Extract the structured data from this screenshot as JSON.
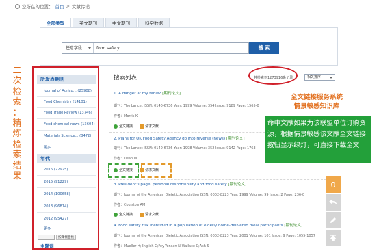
{
  "breadcrumb": {
    "prefix": "您所在的位置：",
    "home": "首页",
    "separator": ">",
    "current": "文献传递"
  },
  "tabs": [
    {
      "label": "全部类型",
      "active": true
    },
    {
      "label": "英文期刊",
      "active": false
    },
    {
      "label": "中文期刊",
      "active": false
    },
    {
      "label": "科学数据",
      "active": false
    }
  ],
  "search": {
    "field_select": "任意字段",
    "query": "food safety",
    "button": "搜 索"
  },
  "annotation_left": [
    "二",
    "次",
    "检",
    "索",
    "：",
    "精",
    "炼",
    "检",
    "索",
    "结",
    "果"
  ],
  "sidebar": {
    "journals_heading": "所发表期刊",
    "journals": [
      "Journal of Agricu... (25908)",
      "Food Chemistry (14101)",
      "Food Trade Review (13746)",
      "Food chemical news (13604)",
      "Materials Science... (8472)"
    ],
    "more_label": "更多",
    "years_heading": "年代",
    "years": [
      "2016 (22925)",
      "2015 (91229)",
      "2014 (100658)",
      "2013 (96814)",
      "2012 (95427)"
    ],
    "year_more": "更多",
    "year_range_button": "按年代查找",
    "subject_heading": "主题词"
  },
  "results": {
    "title": "搜索列表",
    "count": "共检索到1273916条记录",
    "sort": "相关排序",
    "full_text_label": "全文链接",
    "delivery_label": "请求文献",
    "items": [
      {
        "title": "1. A danger at my table?",
        "tag": "[期刊论文]",
        "meta": "期刊：The Lancet ISSN: 0140-6736 Year: 1999 Volume: 354 Issue: 9189 Page: 1565-0",
        "authors": "作者：Morris K"
      },
      {
        "title": "2. Plans for UK Food Safety Agency go into reverse (news)",
        "tag": "[期刊论文]",
        "meta": "期刊：The Lancet ISSN: 0140-6736 Year: 1998 Volume: 352 Issue: 9142 Page: 1763",
        "authors": "作者：Dean M"
      },
      {
        "title": "3. President's page: personal responsibility and food safety",
        "tag": "[期刊论文]",
        "meta": "期刊：Journal of the American Dietetic Association ISSN: 0002-8223 Year: 1999 Volume: 99 Issue: 2 Page: 236-0",
        "authors": "作者：Coulston AM"
      },
      {
        "title": "4. Food safety risk identified in a population of elderly home-delivered meal participants",
        "tag": "[期刊论文]",
        "meta": "期刊：Journal of the American Dietetic Association ISSN: 0002-8223 Year: 2001 Volume: 101 Issue: 9 Page: 1055-1057",
        "authors": "作者：Mueller H;English C;Fey-Yensan N;Wallace C;Ash S"
      }
    ]
  },
  "annotation_title": [
    "全文链接服务系统",
    "情景敏感知识库"
  ],
  "annotation_box": "命中文献如果为该联盟单位订购资源，根据情景敏感该文献全文链接按钮显示绿灯，可直接下载全文",
  "tools": {
    "top_label": "0"
  },
  "colors": {
    "accent_blue": "#1f5fa8",
    "highlight_red": "#d0202a",
    "annotation_orange": "#e2701f",
    "annotation_green": "#23a03a",
    "fulltext_green": "#3fa33a",
    "delivery_orange": "#e39a2b"
  }
}
